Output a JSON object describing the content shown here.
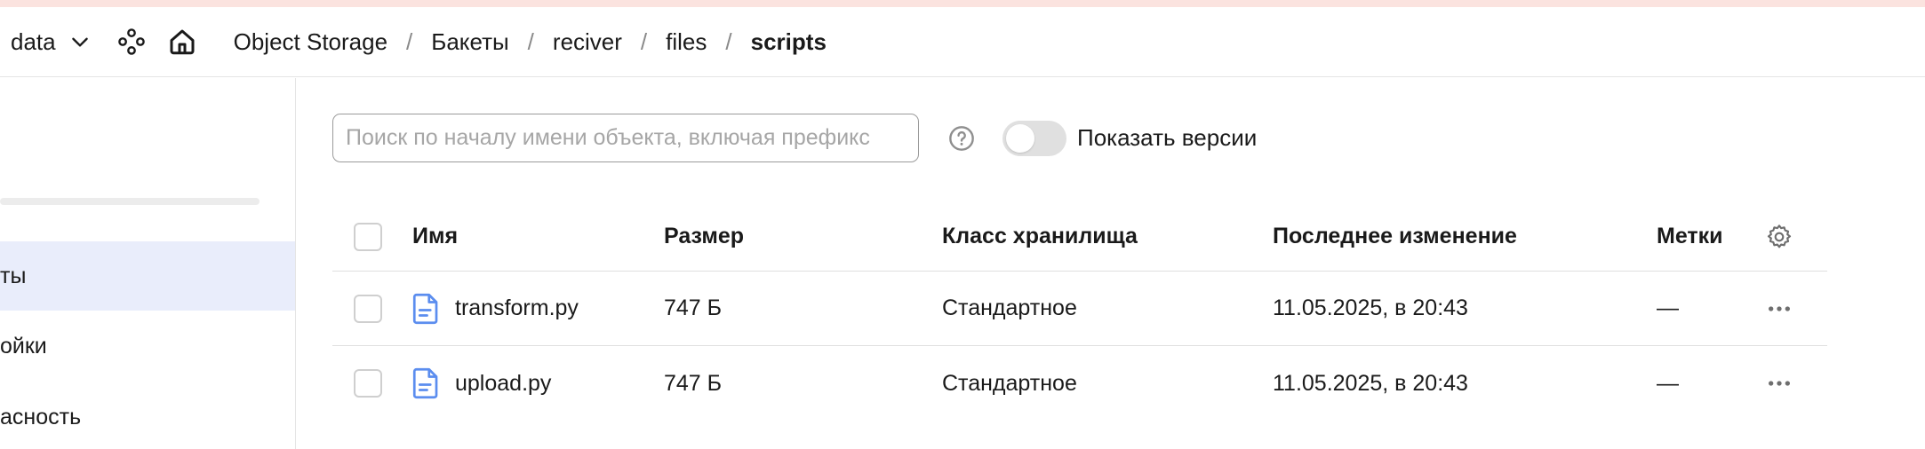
{
  "header": {
    "folder": "data",
    "breadcrumb": [
      "Object Storage",
      "Бакеты",
      "reciver",
      "files"
    ],
    "current": "scripts",
    "separator": "/"
  },
  "sidebar": {
    "items": [
      {
        "label": "ты",
        "active": true
      },
      {
        "label": "ойки",
        "active": false
      },
      {
        "label": "асность",
        "active": false
      }
    ]
  },
  "search": {
    "placeholder": "Поиск по началу имени объекта, включая префикс",
    "value": ""
  },
  "versions_toggle": {
    "label": "Показать версии",
    "on": false
  },
  "table": {
    "columns": [
      "Имя",
      "Размер",
      "Класс хранилища",
      "Последнее изменение",
      "Метки"
    ],
    "rows": [
      {
        "name": "transform.py",
        "size": "747 Б",
        "class": "Стандартное",
        "modified": "11.05.2025, в 20:43",
        "tags": "—"
      },
      {
        "name": "upload.py",
        "size": "747 Б",
        "class": "Стандартное",
        "modified": "11.05.2025, в 20:43",
        "tags": "—"
      }
    ]
  },
  "icons": {
    "folder_chevron": "chevron-down-icon",
    "services": "services-icon",
    "home": "home-icon",
    "help": "help-icon",
    "settings": "gear-icon",
    "file": "file-icon",
    "more": "more-icon"
  },
  "colors": {
    "accent": "#2b6fe6",
    "sidebar_active": "#e9edfb",
    "top_stripe": "#fbe3df",
    "toggle_off": "#e0e0e0",
    "file_icon": "#5b8def"
  }
}
